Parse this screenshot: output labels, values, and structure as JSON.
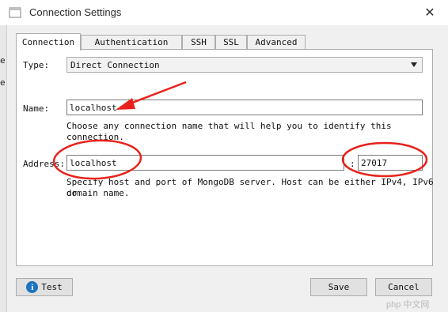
{
  "window": {
    "title": "Connection Settings",
    "close_glyph": "✕",
    "app_icon": "app-window-icon"
  },
  "stray_text": [
    "e",
    "e"
  ],
  "tabs": [
    {
      "label": "Connection",
      "active": true
    },
    {
      "label": "Authentication",
      "active": false
    },
    {
      "label": "SSH",
      "active": false
    },
    {
      "label": "SSL",
      "active": false
    },
    {
      "label": "Advanced",
      "active": false
    }
  ],
  "form": {
    "type_label": "Type:",
    "type_value": "Direct Connection",
    "name_label": "Name:",
    "name_value": "localhost",
    "name_hint": "Choose any connection name that will help you to identify this connection.",
    "address_label": "Address:",
    "address_value": "localhost",
    "port_separator": ":",
    "port_value": "27017",
    "address_hint_line1": "Specify host and port of MongoDB server. Host can be either IPv4, IPv6 or",
    "address_hint_line2": "domain name."
  },
  "footer": {
    "test_label": "Test",
    "save_label": "Save",
    "cancel_label": "Cancel"
  },
  "watermark": "php 中文网",
  "colors": {
    "annotation_red": "#e8221b",
    "info_blue": "#1e73be"
  }
}
